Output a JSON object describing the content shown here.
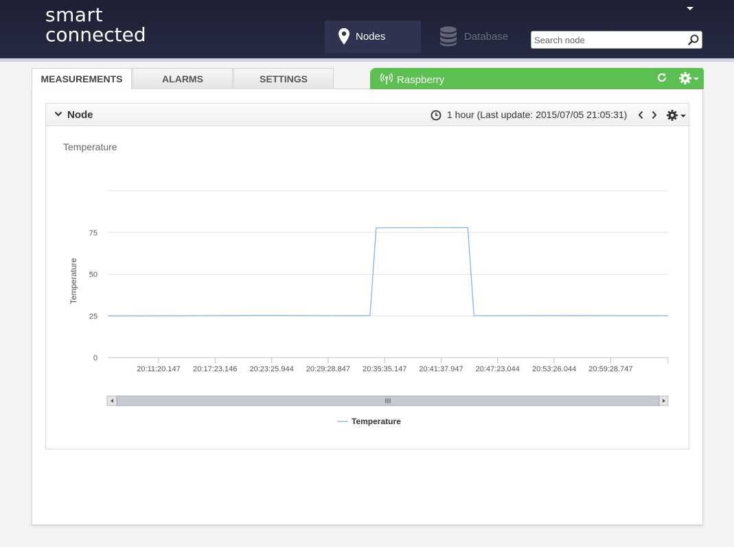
{
  "header": {
    "logo_line1": "smart",
    "logo_line2": "connected",
    "nav": [
      {
        "label": "Nodes",
        "icon": "map-pin-icon",
        "active": true
      },
      {
        "label": "Database",
        "icon": "database-icon",
        "active": false
      }
    ],
    "search": {
      "placeholder": "Search node",
      "value": ""
    }
  },
  "tabs": [
    {
      "label": "MEASUREMENTS",
      "active": true
    },
    {
      "label": "ALARMS",
      "active": false
    },
    {
      "label": "SETTINGS",
      "active": false
    }
  ],
  "node_bar": {
    "title": "Raspberry",
    "color": "#5cbf52"
  },
  "widget": {
    "title": "Node",
    "range_text": "1 hour (Last update: 2015/07/05 21:05:31)"
  },
  "colors": {
    "line": "#7cb5ec",
    "header_bg": "#1d1f33",
    "accent": "#e2231a"
  },
  "chart_data": {
    "type": "line",
    "title": "Temperature",
    "ylabel": "Temperature",
    "xlabel": "",
    "ylim": [
      0,
      100
    ],
    "yticks": [
      0,
      25,
      50,
      75
    ],
    "xticks": [
      "20:11:20.147",
      "20:17:23.146",
      "20:23:25.944",
      "20:29:28.847",
      "20:35:35.147",
      "20:41:37.947",
      "20:47:23.044",
      "20:53:26.044",
      "20:59:28.747"
    ],
    "xdomain": [
      "20:05:20",
      "21:05:31"
    ],
    "grid": true,
    "legend": "bottom",
    "series": [
      {
        "name": "Temperature",
        "points": [
          [
            "20:05:20",
            25.0
          ],
          [
            "20:15:00",
            25.1
          ],
          [
            "20:22:00",
            25.3
          ],
          [
            "20:30:00",
            25.1
          ],
          [
            "20:33:30",
            25.2
          ],
          [
            "20:34:10",
            77.8
          ],
          [
            "20:44:00",
            78.0
          ],
          [
            "20:44:40",
            25.1
          ],
          [
            "20:55:00",
            25.2
          ],
          [
            "21:05:31",
            25.1
          ]
        ]
      }
    ],
    "navigator_scrollbar": true
  }
}
